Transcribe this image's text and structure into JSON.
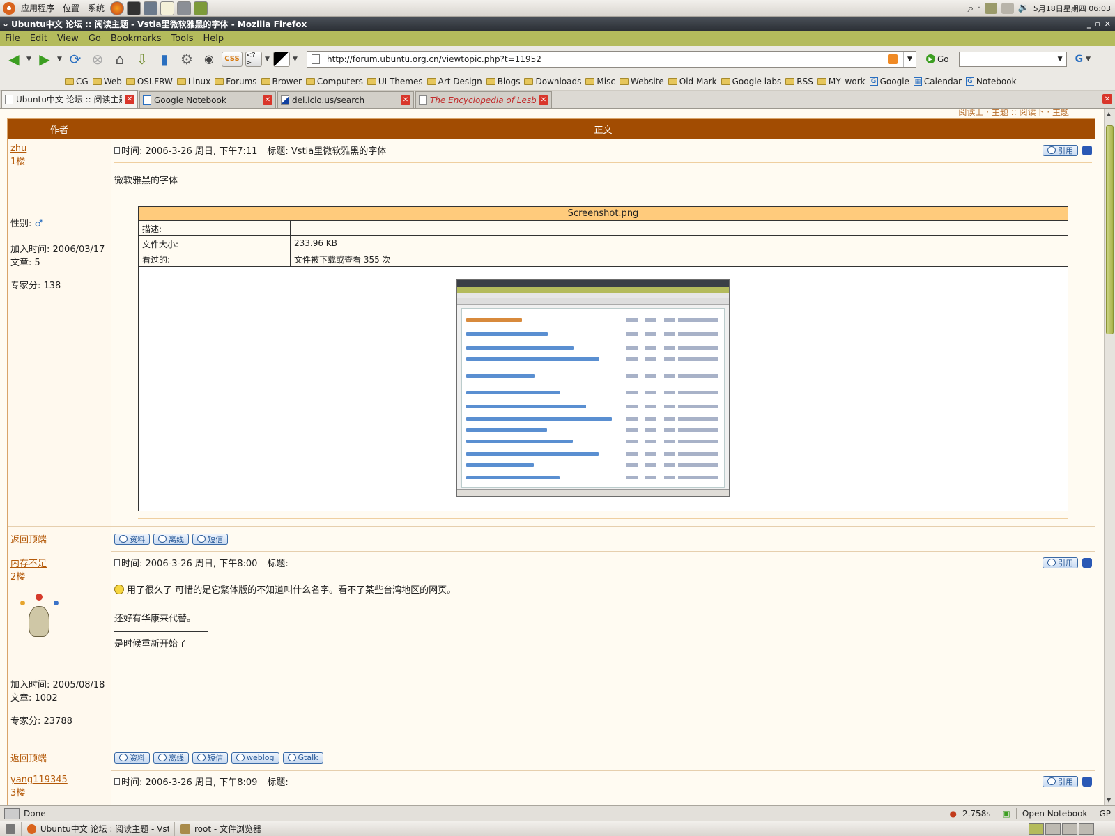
{
  "top_panel": {
    "menus": [
      "应用程序",
      "位置",
      "系统"
    ],
    "clock": "5月18日星期四 06:03"
  },
  "window": {
    "title": "Ubuntu中文 论坛 :: 阅读主题 - Vstia里微软雅黑的字体 - Mozilla Firefox"
  },
  "menubar": [
    "File",
    "Edit",
    "View",
    "Go",
    "Bookmarks",
    "Tools",
    "Help"
  ],
  "navbar": {
    "url": "http://forum.ubuntu.org.cn/viewtopic.php?t=11952",
    "go_label": "Go",
    "css_label": "CSS"
  },
  "bookmarks": [
    {
      "label": "CG",
      "icon": "folder"
    },
    {
      "label": "Web",
      "icon": "folder"
    },
    {
      "label": "OSI.FRW",
      "icon": "folder"
    },
    {
      "label": "Linux",
      "icon": "folder"
    },
    {
      "label": "Forums",
      "icon": "folder"
    },
    {
      "label": "Brower",
      "icon": "folder"
    },
    {
      "label": "Computers",
      "icon": "folder"
    },
    {
      "label": "UI Themes",
      "icon": "folder"
    },
    {
      "label": "Art Design",
      "icon": "folder"
    },
    {
      "label": "Blogs",
      "icon": "folder"
    },
    {
      "label": "Downloads",
      "icon": "folder"
    },
    {
      "label": "Misc",
      "icon": "folder"
    },
    {
      "label": "Website",
      "icon": "folder"
    },
    {
      "label": "Old Mark",
      "icon": "folder"
    },
    {
      "label": "Google labs",
      "icon": "folder"
    },
    {
      "label": "RSS",
      "icon": "folder"
    },
    {
      "label": "MY_work",
      "icon": "folder"
    },
    {
      "label": "Google",
      "icon": "google"
    },
    {
      "label": "Calendar",
      "icon": "calendar"
    },
    {
      "label": "Notebook",
      "icon": "google"
    }
  ],
  "tabs": [
    {
      "title": "Ubuntu中文 论坛 :: 阅读主题...",
      "active": true
    },
    {
      "title": "Google Notebook",
      "active": false
    },
    {
      "title": "del.icio.us/search",
      "active": false
    },
    {
      "title": "The Encyclopedia of Lesbia...",
      "active": false
    }
  ],
  "forum": {
    "top_nav": "阅读上 · 主题 :: 阅读下 · 主题",
    "header_author": "作者",
    "header_body": "正文",
    "back_to_top": "返回顶端",
    "quote_label": "引用",
    "buttons": {
      "profile": "资料",
      "offline": "离线",
      "pm": "短信",
      "weblog": "weblog",
      "gtalk": "Gtalk"
    },
    "posts": [
      {
        "username": "zhu",
        "floor": "1楼",
        "gender_label": "性别:",
        "join_date": "加入时间: 2006/03/17",
        "post_count": "文章: 5",
        "expert_score": "专家分: 138",
        "time": "时间: 2006-3-26 周日, 下午7:11",
        "subject": "标题: Vstia里微软雅黑的字体",
        "body": "微软雅黑的字体",
        "attachment": {
          "filename": "Screenshot.png",
          "desc_label": "描述:",
          "desc_value": "",
          "size_label": "文件大小:",
          "size_value": "233.96 KB",
          "views_label": "看过的:",
          "views_value": "文件被下载或查看 355 次"
        }
      },
      {
        "username": "内存不足",
        "floor": "2楼",
        "join_date": "加入时间: 2005/08/18",
        "post_count": "文章: 1002",
        "expert_score": "专家分: 23788",
        "time": "时间: 2006-3-26 周日, 下午8:00",
        "subject": "标题:",
        "body_line1": "用了很久了 可惜的是它繁体版的不知道叫什么名字。看不了某些台湾地区的网页。",
        "body_line2": "还好有华康来代替。",
        "signature_rule": "_________________",
        "signature": "是时候重新开始了"
      },
      {
        "username": "yang119345",
        "floor": "3楼",
        "time": "时间: 2006-3-26 周日, 下午8:09",
        "subject": "标题:"
      }
    ]
  },
  "statusbar": {
    "status": "Done",
    "timing": "2.758s",
    "notebook": "Open Notebook",
    "gp": "GP"
  },
  "taskbar": {
    "tasks": [
      "Ubuntu中文 论坛 : 阅读主题 - Vsti...",
      "root - 文件浏览器"
    ]
  },
  "colors": {
    "forum_header": "#a24c02",
    "attachment_header": "#ffcb7c",
    "menubar": "#b4bb5c",
    "link": "#b45a0a"
  }
}
